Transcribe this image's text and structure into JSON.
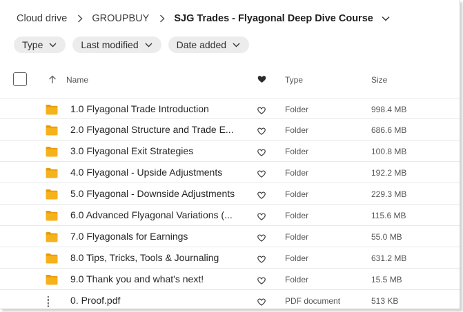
{
  "breadcrumb": {
    "items": [
      "Cloud drive",
      "GROUPBUY"
    ],
    "current": "SJG Trades - Flyagonal Deep Dive Course"
  },
  "filters": [
    "Type",
    "Last modified",
    "Date added"
  ],
  "columns": {
    "name": "Name",
    "type": "Type",
    "size": "Size"
  },
  "rows": [
    {
      "name": "1.0 Flyagonal Trade Introduction",
      "type": "Folder",
      "size": "998.4 MB",
      "icon": "folder-icon"
    },
    {
      "name": "2.0 Flyagonal Structure and Trade E...",
      "type": "Folder",
      "size": "686.6 MB",
      "icon": "folder-icon"
    },
    {
      "name": "3.0 Flyagonal Exit Strategies",
      "type": "Folder",
      "size": "100.8 MB",
      "icon": "folder-icon"
    },
    {
      "name": "4.0 Flyagonal - Upside Adjustments",
      "type": "Folder",
      "size": "192.2 MB",
      "icon": "folder-icon"
    },
    {
      "name": "5.0 Flyagonal - Downside Adjustments",
      "type": "Folder",
      "size": "229.3 MB",
      "icon": "folder-icon"
    },
    {
      "name": "6.0 Advanced Flyagonal Variations (...",
      "type": "Folder",
      "size": "115.6 MB",
      "icon": "folder-icon"
    },
    {
      "name": "7.0 Flyagonals for Earnings",
      "type": "Folder",
      "size": "55.0 MB",
      "icon": "folder-icon"
    },
    {
      "name": "8.0 Tips, Tricks, Tools & Journaling",
      "type": "Folder",
      "size": "631.2 MB",
      "icon": "folder-icon"
    },
    {
      "name": "9.0 Thank you and what's next!",
      "type": "Folder",
      "size": "15.5 MB",
      "icon": "folder-icon"
    },
    {
      "name": "0. Proof.pdf",
      "type": "PDF document",
      "size": "513 KB",
      "icon": "pdf-file-icon"
    }
  ],
  "colors": {
    "folder": "#f6b21b",
    "folder_tab": "#e79c0f",
    "heart": "#2a2a2a"
  }
}
